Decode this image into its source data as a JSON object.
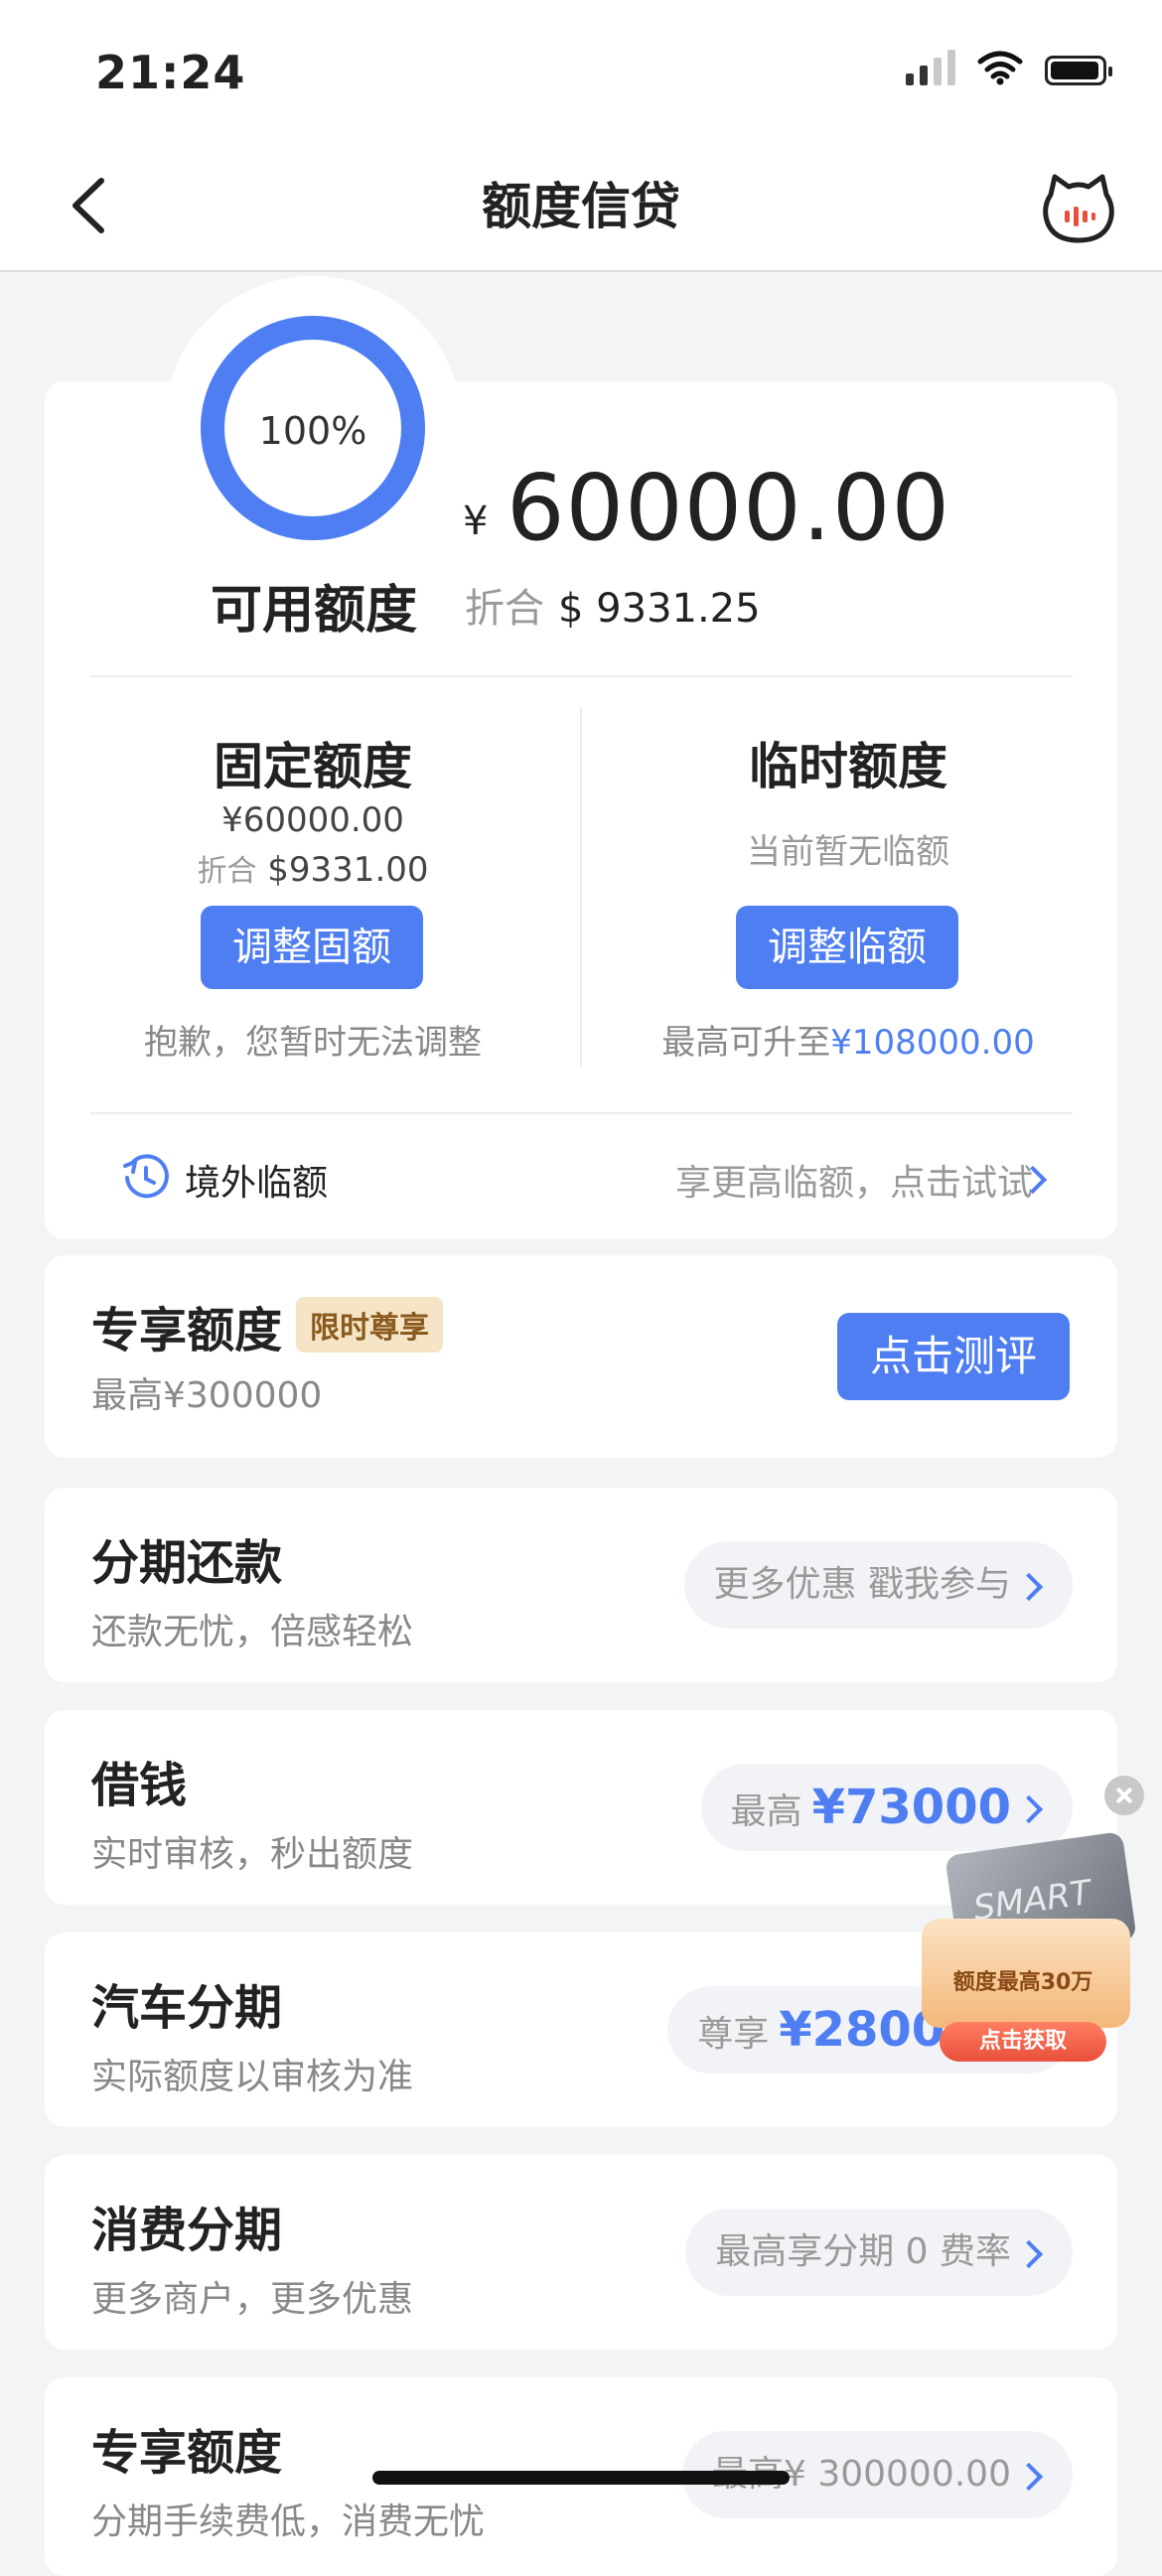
{
  "status_bar": {
    "time": "21:24"
  },
  "nav": {
    "title": "额度信贷",
    "back_icon": "chevron-left-icon",
    "mascot_icon": "cat-mascot-icon"
  },
  "credit": {
    "usage_percent": "100%",
    "ring_fill_fraction": 1.0,
    "available_label": "可用额度",
    "currency_symbol": "¥",
    "available_amount": "60000.00",
    "converted_label": "折合",
    "converted_amount": "$ 9331.25"
  },
  "fixed": {
    "title": "固定额度",
    "amount": "¥60000.00",
    "converted_label": "折合",
    "converted_amount": "$9331.00",
    "button": "调整固额",
    "note": "抱歉，您暂时无法调整"
  },
  "temporary": {
    "title": "临时额度",
    "status": "当前暂无临额",
    "button": "调整临额",
    "note_prefix": "最高可升至",
    "note_amount": "¥108000.00"
  },
  "overseas": {
    "label": "境外临额",
    "hint": "享更高临额，点击试试",
    "icon": "clock-airplane-icon"
  },
  "exclusive": {
    "title": "专享额度",
    "tag": "限时尊享",
    "subtitle": "最高¥300000",
    "button": "点击测评"
  },
  "rows": [
    {
      "title": "分期还款",
      "subtitle": "还款无忧，倍感轻松",
      "pill_text": "更多优惠 戳我参与",
      "pill_value": ""
    },
    {
      "title": "借钱",
      "subtitle": "实时审核，秒出额度",
      "pill_text": "最高",
      "pill_value": "¥73000"
    },
    {
      "title": "汽车分期",
      "subtitle": "实际额度以审核为准",
      "pill_text": "尊享",
      "pill_value": "¥280000"
    },
    {
      "title": "消费分期",
      "subtitle": "更多商户，更多优惠",
      "pill_text": "最高享分期 0 费率",
      "pill_value": ""
    },
    {
      "title": "专享额度",
      "subtitle": "分期手续费低，消费无忧",
      "pill_text": "最高¥ 300000.00",
      "pill_value": ""
    }
  ],
  "float_ad": {
    "card_text": "SMART",
    "caption": "额度最高30万",
    "cta": "点击获取"
  },
  "colors": {
    "accent": "#4e7ef2",
    "tag_bg": "#f5e5c6",
    "tag_text": "#8a5a1d",
    "background": "#f3f4f6"
  }
}
